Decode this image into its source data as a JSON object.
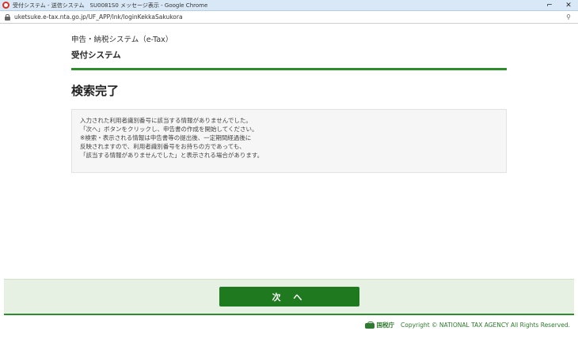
{
  "window": {
    "title": "受付システム - 送信システム　SU0081S0 メッセージ表示 - Google Chrome",
    "minimize_glyph": "⌐",
    "close_glyph": "✕"
  },
  "address": {
    "url": "uketsuke.e-tax.nta.go.jp/UF_APP/lnk/loginKekkaSakukora",
    "key_glyph": "⚲"
  },
  "header": {
    "system_name": "申告・納税システム（e-Tax）",
    "subsystem_name": "受付システム"
  },
  "main": {
    "title": "検索完了",
    "message_lines": [
      "入力された利用者識別番号に該当する情報がありませんでした。",
      "「次へ」ボタンをクリックし、申告書の作成を開始してください。",
      "※検索・表示される情報は申告書等の提出後、一定期間経過後に",
      "反映されますので、利用者識別番号をお持ちの方であっても、",
      "「該当する情報がありませんでした」と表示される場合があります。"
    ]
  },
  "actions": {
    "next_label": "次 へ"
  },
  "footer": {
    "logo_text": "国税庁",
    "copyright": "Copyright © NATIONAL TAX AGENCY All Rights Reserved."
  },
  "colors": {
    "brand_green": "#2e8b2e",
    "button_green": "#1f7a1f",
    "footer_band": "#e6f1e3"
  }
}
